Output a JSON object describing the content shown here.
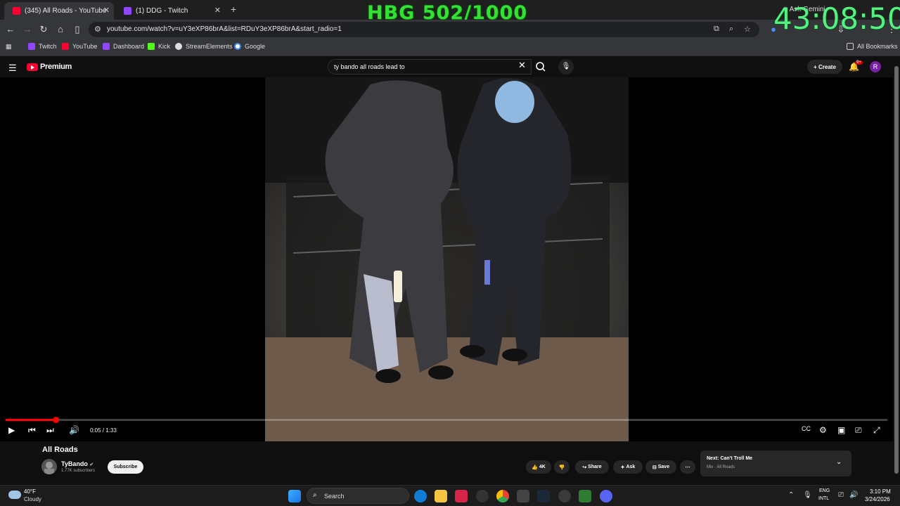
{
  "browser": {
    "tabs": [
      {
        "label": "(345) All Roads - YouTube",
        "active": true
      },
      {
        "label": "(1) DDG - Twitch",
        "active": false
      }
    ],
    "url": "youtube.com/watch?v=uY3eXP86brA&list=RDuY3eXP86brA&start_radio=1",
    "ask_gemini": "Ask Gemini",
    "bookmarks": [
      "Twitch",
      "YouTube",
      "Dashboard",
      "Kick",
      "StreamElements",
      "Google"
    ],
    "all_bookmarks": "All Bookmarks"
  },
  "overlay": {
    "counter": "HBG 502/1000",
    "timer": "43:08:50"
  },
  "youtube": {
    "logo_text": "Premium",
    "search_value": "ty bando all roads lead to",
    "create_label": "Create",
    "notif_badge": "9+",
    "avatar_letter": "R"
  },
  "player": {
    "progress": 0.057,
    "time": "0:05 / 1:33"
  },
  "video": {
    "title": "All Roads",
    "channel": "TyBando",
    "subscribers": "1.77K subscribers",
    "subscribe_label": "Subscribe",
    "likes": "4K",
    "share_label": "Share",
    "ask_label": "Ask",
    "save_label": "Save"
  },
  "up_next": {
    "title": "Next: Can't Troll Me",
    "subtitle": "Mix · All Roads"
  },
  "taskbar": {
    "temp": "40°F",
    "condition": "Cloudy",
    "search_label": "Search",
    "lang1": "ENG",
    "lang2": "INTL",
    "time": "3:10 PM",
    "date": "3/24/2026"
  },
  "colors": {
    "youtube_red": "#ff0000",
    "overlay_green": "#33e033",
    "timer_green": "#54f080"
  }
}
